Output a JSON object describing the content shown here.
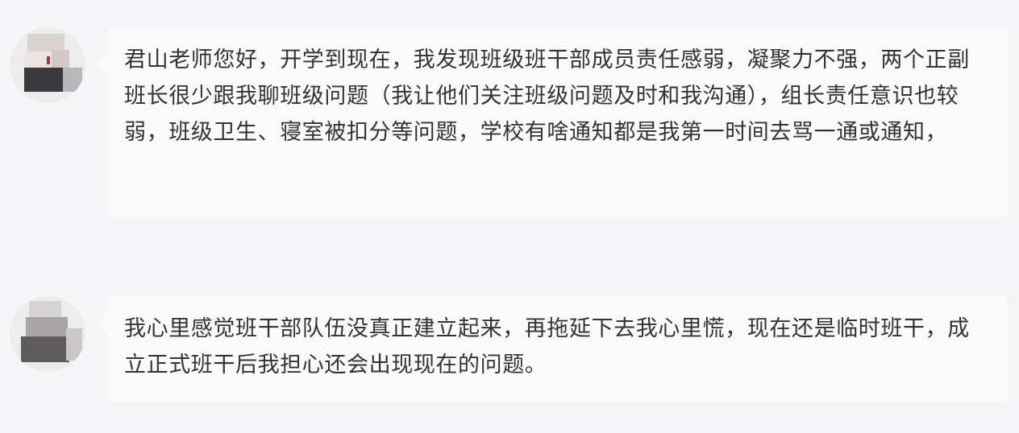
{
  "messages": [
    {
      "avatar": "blurred-avatar",
      "text": "君山老师您好，开学到现在，我发现班级班干部成员责任感弱，凝聚力不强，两个正副班长很少跟我聊班级问题（我让他们关注班级问题及时和我沟通），组长责任意识也较弱，班级卫生、寝室被扣分等问题，学校有啥通知都是我第一时间去骂一通或通知，"
    },
    {
      "avatar": "blurred-avatar",
      "text": "我心里感觉班干部队伍没真正建立起来，再拖延下去我心里慌，现在还是临时班干，成立正式班干后我担心还会出现现在的问题。"
    }
  ],
  "colors": {
    "background": "#f5f5f7",
    "bubble": "#fafafb",
    "text": "#333333"
  }
}
